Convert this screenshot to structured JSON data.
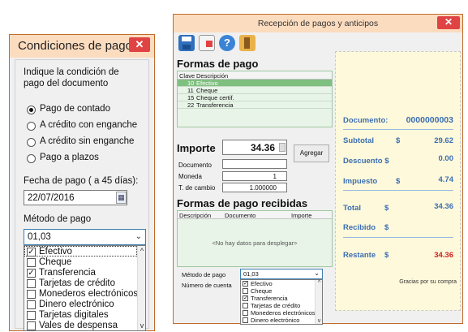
{
  "dialog_left": {
    "title": "Condiciones de pago",
    "close_label": "✕",
    "instruction_line1": "Indique la condición de",
    "instruction_line2": "pago del documento",
    "radio_options": [
      {
        "label": "Pago de contado",
        "checked": true
      },
      {
        "label": "A crédito con enganche",
        "checked": false
      },
      {
        "label": "A crédito sin enganche",
        "checked": false
      },
      {
        "label": "Pago a plazos",
        "checked": false
      }
    ],
    "date_label": "Fecha de pago ( a 45 días):",
    "date_value": "22/07/2016",
    "method_label": "Método de pago",
    "method_value": "01,03",
    "method_options": [
      {
        "label": "Efectivo",
        "checked": true
      },
      {
        "label": "Cheque",
        "checked": false
      },
      {
        "label": "Transferencia",
        "checked": true
      },
      {
        "label": "Tarjetas de crédito",
        "checked": false
      },
      {
        "label": "Monederos electrónicos",
        "checked": false
      },
      {
        "label": "Dinero electrónico",
        "checked": false
      },
      {
        "label": "Tarjetas digitales",
        "checked": false
      },
      {
        "label": "Vales de despensa",
        "checked": false
      }
    ]
  },
  "window_right": {
    "title": "Recepción de pagos y anticipos",
    "close_label": "✕",
    "toolbar_icons": [
      "save-icon",
      "document-icon",
      "help-icon",
      "exit-icon"
    ],
    "formas_title": "Formas de pago",
    "formas_headers": [
      "Clave",
      "Descripción"
    ],
    "formas_rows": [
      {
        "clave": "10",
        "descripcion": "Efectivo",
        "selected": true
      },
      {
        "clave": "11",
        "descripcion": "Cheque",
        "selected": false
      },
      {
        "clave": "15",
        "descripcion": "Cheque certif.",
        "selected": false
      },
      {
        "clave": "22",
        "descripcion": "Transferencia",
        "selected": false
      }
    ],
    "importe_label": "Importe",
    "importe_value": "34.36",
    "agregar_label": "Agregar",
    "documento_label": "Documento",
    "moneda_label": "Moneda",
    "moneda_value": "1",
    "tipo_cambio_label": "T. de cambio",
    "tipo_cambio_value": "1.000000",
    "recibidas_title": "Formas de pago recibidas",
    "recibidas_headers": [
      "Descripción",
      "Documento",
      "Importe"
    ],
    "recibidas_empty": "<No hay datos para desplegar>",
    "metodo_label": "Método de pago",
    "metodo_value": "01,03",
    "cuenta_label": "Número de cuenta",
    "metodo_options": [
      {
        "label": "Efectivo",
        "checked": true
      },
      {
        "label": "Cheque",
        "checked": false
      },
      {
        "label": "Transferencia",
        "checked": true
      },
      {
        "label": "Tarjetas de crédito",
        "checked": false
      },
      {
        "label": "Monederos electrónicos",
        "checked": false
      },
      {
        "label": "Dinero electrónico",
        "checked": false
      }
    ],
    "summary": {
      "documento_label": "Documento:",
      "documento_value": "0000000003",
      "subtotal_label": "Subtotal",
      "subtotal_value": "29.62",
      "descuento_label": "Descuento $",
      "descuento_value": "0.00",
      "impuesto_label": "Impuesto",
      "impuesto_value": "4.74",
      "total_label": "Total",
      "total_value": "34.36",
      "recibido_label": "Recibido",
      "restante_label": "Restante",
      "restante_value": "34.36",
      "currency": "$",
      "thanks": "Gracias por su compra"
    }
  },
  "colors": {
    "title_bar": "#fcdcbf",
    "border": "#c06a2c",
    "close": "#e04343",
    "summary_bg": "#fff9db",
    "summary_text": "#3a6eb2",
    "restante_text": "#d02020",
    "grid_bg": "#e8f4e8",
    "selected_row": "#7fbf7f"
  }
}
